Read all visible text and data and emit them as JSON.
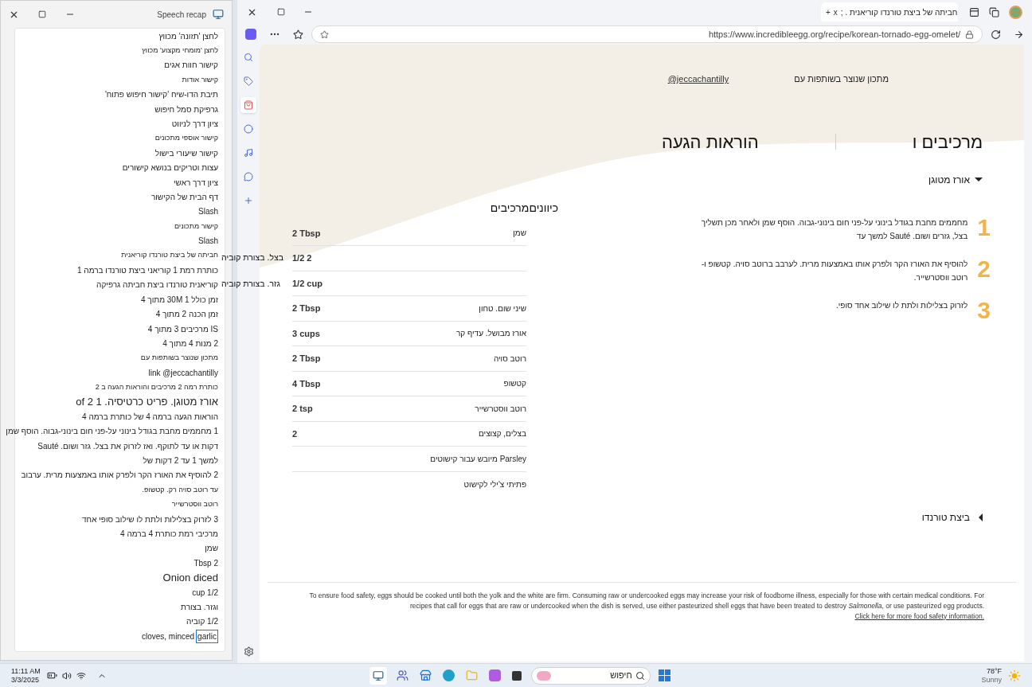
{
  "speech_recap": {
    "title": "Speech recap",
    "lines": [
      {
        "kind": "normal",
        "text": "לחצן 'תזונה' מכווץ"
      },
      {
        "kind": "small",
        "text": "לחצן 'מומחי מקצוע' מכווץ"
      },
      {
        "kind": "normal",
        "text": "קישור חוות אגים"
      },
      {
        "kind": "small",
        "text": "קישור אודות"
      },
      {
        "kind": "normal",
        "text": "תיבת הדו-שיח 'קישור חיפוש פתוח'"
      },
      {
        "kind": "normal",
        "text": "גרפיקת סמל חיפוש"
      },
      {
        "kind": "normal",
        "text": "ציון דרך לניווט"
      },
      {
        "kind": "small",
        "text": "קישור אוספי מתכונים"
      },
      {
        "kind": "normal",
        "text": "קישור שיעורי בישול"
      },
      {
        "kind": "normal",
        "text": "עצות וטריקים בנושא קישורים"
      },
      {
        "kind": "normal",
        "text": "ציון דרך ראשי"
      },
      {
        "kind": "normal",
        "text": "דף הבית של הקישור"
      },
      {
        "kind": "normal",
        "text": "Slash"
      },
      {
        "kind": "small",
        "text": "קישור מתכונים"
      },
      {
        "kind": "normal",
        "text": "Slash"
      },
      {
        "kind": "small",
        "text": "חביתה של ביצת טורנדו קוריאנית"
      },
      {
        "kind": "normal",
        "text": "כותרת רמת 1 קוריאני ביצת טורנדו ברמה 1"
      },
      {
        "kind": "normal",
        "text": "קוריאנית טורנדו ביצת חביתה גרפיקה"
      },
      {
        "kind": "normal",
        "text": "זמן כולל 1 30M מתוך 4"
      },
      {
        "kind": "normal",
        "text": "זמן הכנה 2 מתוך 4"
      },
      {
        "kind": "normal",
        "text": "IS מרכיבים 3 מתוך 4"
      },
      {
        "kind": "normal",
        "text": "2 מנות 4 מתוך 4"
      },
      {
        "kind": "small",
        "text": "מתכון שנוצר בשותפות עם"
      },
      {
        "kind": "normal",
        "text": "link @jeccachantilly"
      },
      {
        "kind": "small",
        "text": "כותרת רמה 2 מרכיבים והוראות הגעה ב 2"
      },
      {
        "kind": "large",
        "text": "אורז מטוגן. פריט כרטיסיה. 1 of 2"
      },
      {
        "kind": "normal",
        "text": "הוראות הגעה ברמה 4 של כותרת ברמה 4"
      },
      {
        "kind": "normal",
        "text": "1 מחממים מחבת בגודל בינוני על-פני חום בינוני-גבוה. הוסף שמן"
      },
      {
        "kind": "normal",
        "text": "דקות או עד לתוקף. ואז לזרוק את בצל. גזר ושום. Sauté"
      },
      {
        "kind": "normal",
        "text": "למשך 1 עד 2 דקות של"
      },
      {
        "kind": "normal",
        "text": "2 להוסיף את האורז הקר ולפרק אותו באמצעות מרית. ערבוב"
      },
      {
        "kind": "small",
        "text": "עד רוטב סויה רק. קטשופ."
      },
      {
        "kind": "small",
        "text": "רוטב ווסטרשייר"
      },
      {
        "kind": "normal",
        "text": "3 לזרוק בצלילות ולתת לו שילוב סופי אחד"
      },
      {
        "kind": "normal",
        "text": "מרכיבי רמת כותרת 4 ברמה 4"
      },
      {
        "kind": "normal",
        "text": "שמן"
      },
      {
        "kind": "normal",
        "text": "2 Tbsp"
      },
      {
        "kind": "large",
        "text": "Onion diced"
      },
      {
        "kind": "normal",
        "text": "1/2 cup"
      },
      {
        "kind": "normal",
        "text": "וגזר. בצורת"
      },
      {
        "kind": "normal",
        "text": "1/2 קוביה"
      },
      {
        "kind": "focus",
        "focus_word": "garlic",
        "text": "cloves, minced"
      }
    ]
  },
  "overflow_captions": [
    "בצל. בצורת קוביה",
    "גזר. בצורת קוביה"
  ],
  "browser": {
    "tab_title": "חביתה של ביצת טורנדו קוריאנית . ;",
    "tab_close": "x",
    "new_tab": "+",
    "address": "https://www.incredibleegg.org/recipe/korean-tornado-egg-omelet/"
  },
  "sidebar": {
    "items": [
      {
        "kind": "search",
        "selected": false
      },
      {
        "kind": "tag",
        "selected": false
      },
      {
        "kind": "shopping",
        "selected": true
      },
      {
        "kind": "circle",
        "selected": false
      },
      {
        "kind": "music",
        "selected": false
      },
      {
        "kind": "chat",
        "selected": false
      },
      {
        "kind": "add",
        "selected": false
      }
    ]
  },
  "page": {
    "credit_label": "מתכון שנוצר בשותפות עם",
    "credit_link": "@jeccachantilly",
    "headings": [
      "מרכיבים ו",
      "הוראות הגעה"
    ],
    "sections": [
      {
        "title": "אורז מטוגן",
        "expanded": true
      },
      {
        "title": "ביצת טורנדו",
        "expanded": false
      }
    ],
    "ingredients": {
      "header": "כיווניםמרכיבים",
      "rows": [
        {
          "name": "שמן",
          "amount": "2 Tbsp"
        },
        {
          "amount": "1/2 2"
        },
        {
          "amount": "1/2 cup"
        },
        {
          "name": "שיני שום. טחון",
          "amount": "2 Tbsp"
        },
        {
          "name": "אורז מבושל. עדיף קר",
          "amount": "3 cups"
        },
        {
          "name": "רוטב סויה",
          "amount": "2 Tbsp"
        },
        {
          "name": "קטשופ",
          "amount": "4 Tbsp"
        },
        {
          "name": "רוטב ווסטרשייר",
          "amount": "2 tsp"
        },
        {
          "name": "בצלים, קצוצים",
          "amount": "2"
        },
        {
          "name": "Parsley מיובש עבור קישוטים"
        },
        {
          "name": "פתיתי צ'ילי לקישוט"
        }
      ]
    },
    "steps": [
      {
        "number": "1",
        "text": "מחממים מחבת בגודל בינוני על-פני חום בינוני-גבוה. הוסף שמן ולאחר מכן תשליך בצל, גזרים ושום. Sauté למשך עד"
      },
      {
        "number": "2",
        "text": "להוסיף את האורז הקר ולפרק אותו באמצעות מרית. לערבב ברוטב סויה. קטשופ ו- רוטב ווסטרשייר."
      },
      {
        "number": "3",
        "text": "לזרוק בצלילות ולתת לו שילוב אחד סופי."
      }
    ],
    "safety_text": "To ensure food safety, eggs should be cooked until both the yolk and the white are firm. Consuming raw or undercooked eggs may increase your risk of foodborne illness, especially for those with certain medical conditions. For recipes that call for eggs that are raw or undercooked when the dish is served, use either pasteurized shell eggs that have been treated to destroy *Salmonella*, or use pasteurized egg products.",
    "safety_link": "Click here for more food safety information."
  },
  "taskbar": {
    "time": "11:11 AM",
    "date": "3/3/2025",
    "search_placeholder": "חיפוש",
    "temperature": "78°F",
    "weather": "Sunny"
  }
}
